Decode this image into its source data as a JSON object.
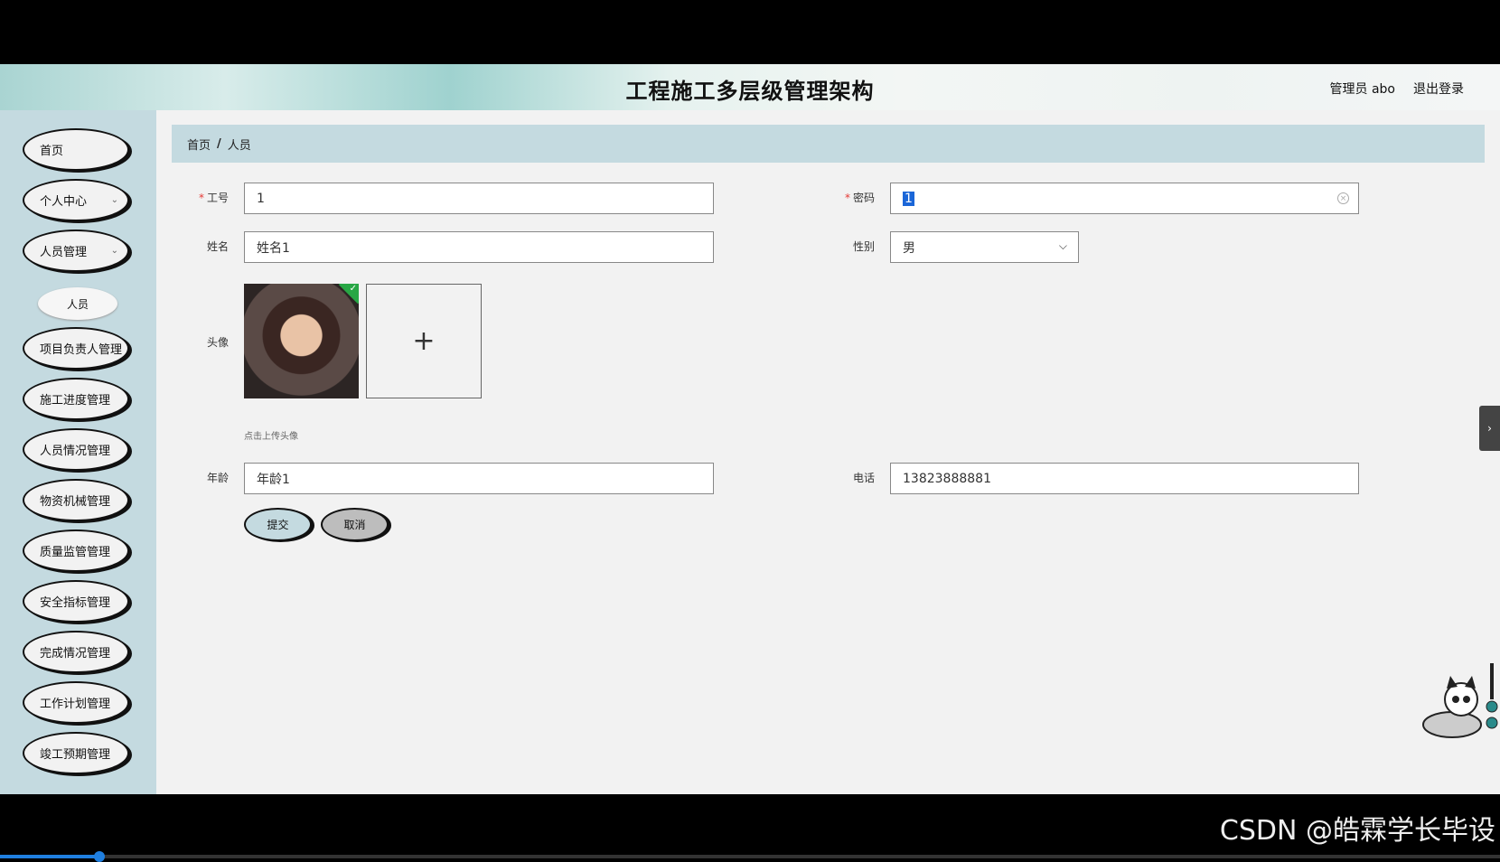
{
  "header": {
    "title": "工程施工多层级管理架构",
    "user": "管理员 abo",
    "logout": "退出登录"
  },
  "sidebar": {
    "items": [
      {
        "label": "首页"
      },
      {
        "label": "个人中心"
      },
      {
        "label": "人员管理"
      },
      {
        "label": "项目负责人管理"
      },
      {
        "label": "施工进度管理"
      },
      {
        "label": "人员情况管理"
      },
      {
        "label": "物资机械管理"
      },
      {
        "label": "质量监管管理"
      },
      {
        "label": "安全指标管理"
      },
      {
        "label": "完成情况管理"
      },
      {
        "label": "工作计划管理"
      },
      {
        "label": "竣工预期管理"
      }
    ],
    "sub_item": "人员"
  },
  "breadcrumb": {
    "home": "首页",
    "sep": "/",
    "current": "人员"
  },
  "form": {
    "id_label": "工号",
    "id_value": "1",
    "password_label": "密码",
    "password_value": "1",
    "name_label": "姓名",
    "name_value": "姓名1",
    "gender_label": "性别",
    "gender_value": "男",
    "avatar_label": "头像",
    "upload_plus": "+",
    "upload_hint": "点击上传头像",
    "age_label": "年龄",
    "age_value": "年龄1",
    "phone_label": "电话",
    "phone_value": "13823888881",
    "submit": "提交",
    "cancel": "取消",
    "required_mark": "*"
  },
  "watermark": "CSDN @皓霖学长毕设",
  "video_progress": 0.066
}
